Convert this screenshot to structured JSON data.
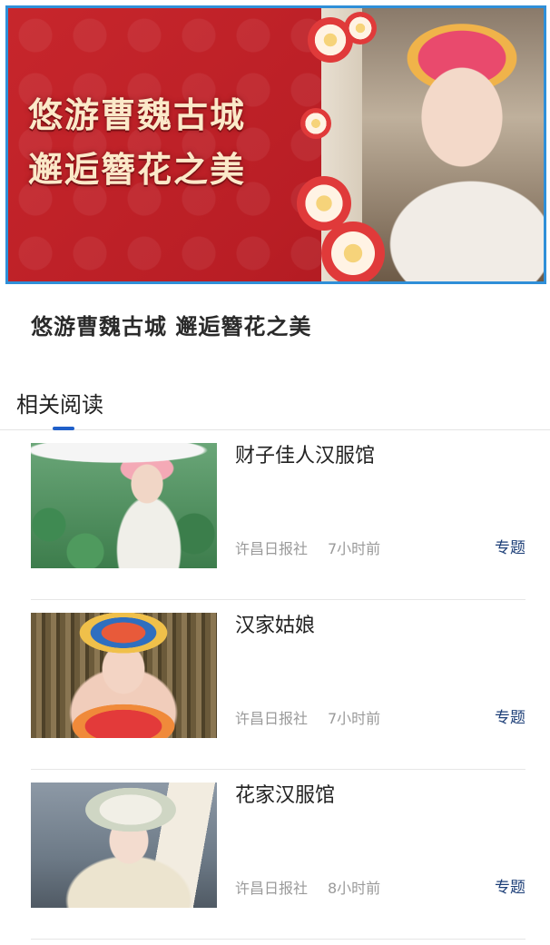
{
  "banner": {
    "title_line1": "悠游曹魏古城",
    "title_line2": "邂逅簪花之美",
    "border_color": "#2f8fd8",
    "background_color": "#c0242a"
  },
  "article": {
    "title": "悠游曹魏古城 邂逅簪花之美"
  },
  "related": {
    "tab_label": "相关阅读",
    "accent_color": "#1f5fc9",
    "items": [
      {
        "title": "财子佳人汉服馆",
        "source": "许昌日报社",
        "time": "7小时前",
        "tag": "专题"
      },
      {
        "title": "汉家姑娘",
        "source": "许昌日报社",
        "time": "7小时前",
        "tag": "专题"
      },
      {
        "title": "花家汉服馆",
        "source": "许昌日报社",
        "time": "8小时前",
        "tag": "专题"
      }
    ]
  }
}
